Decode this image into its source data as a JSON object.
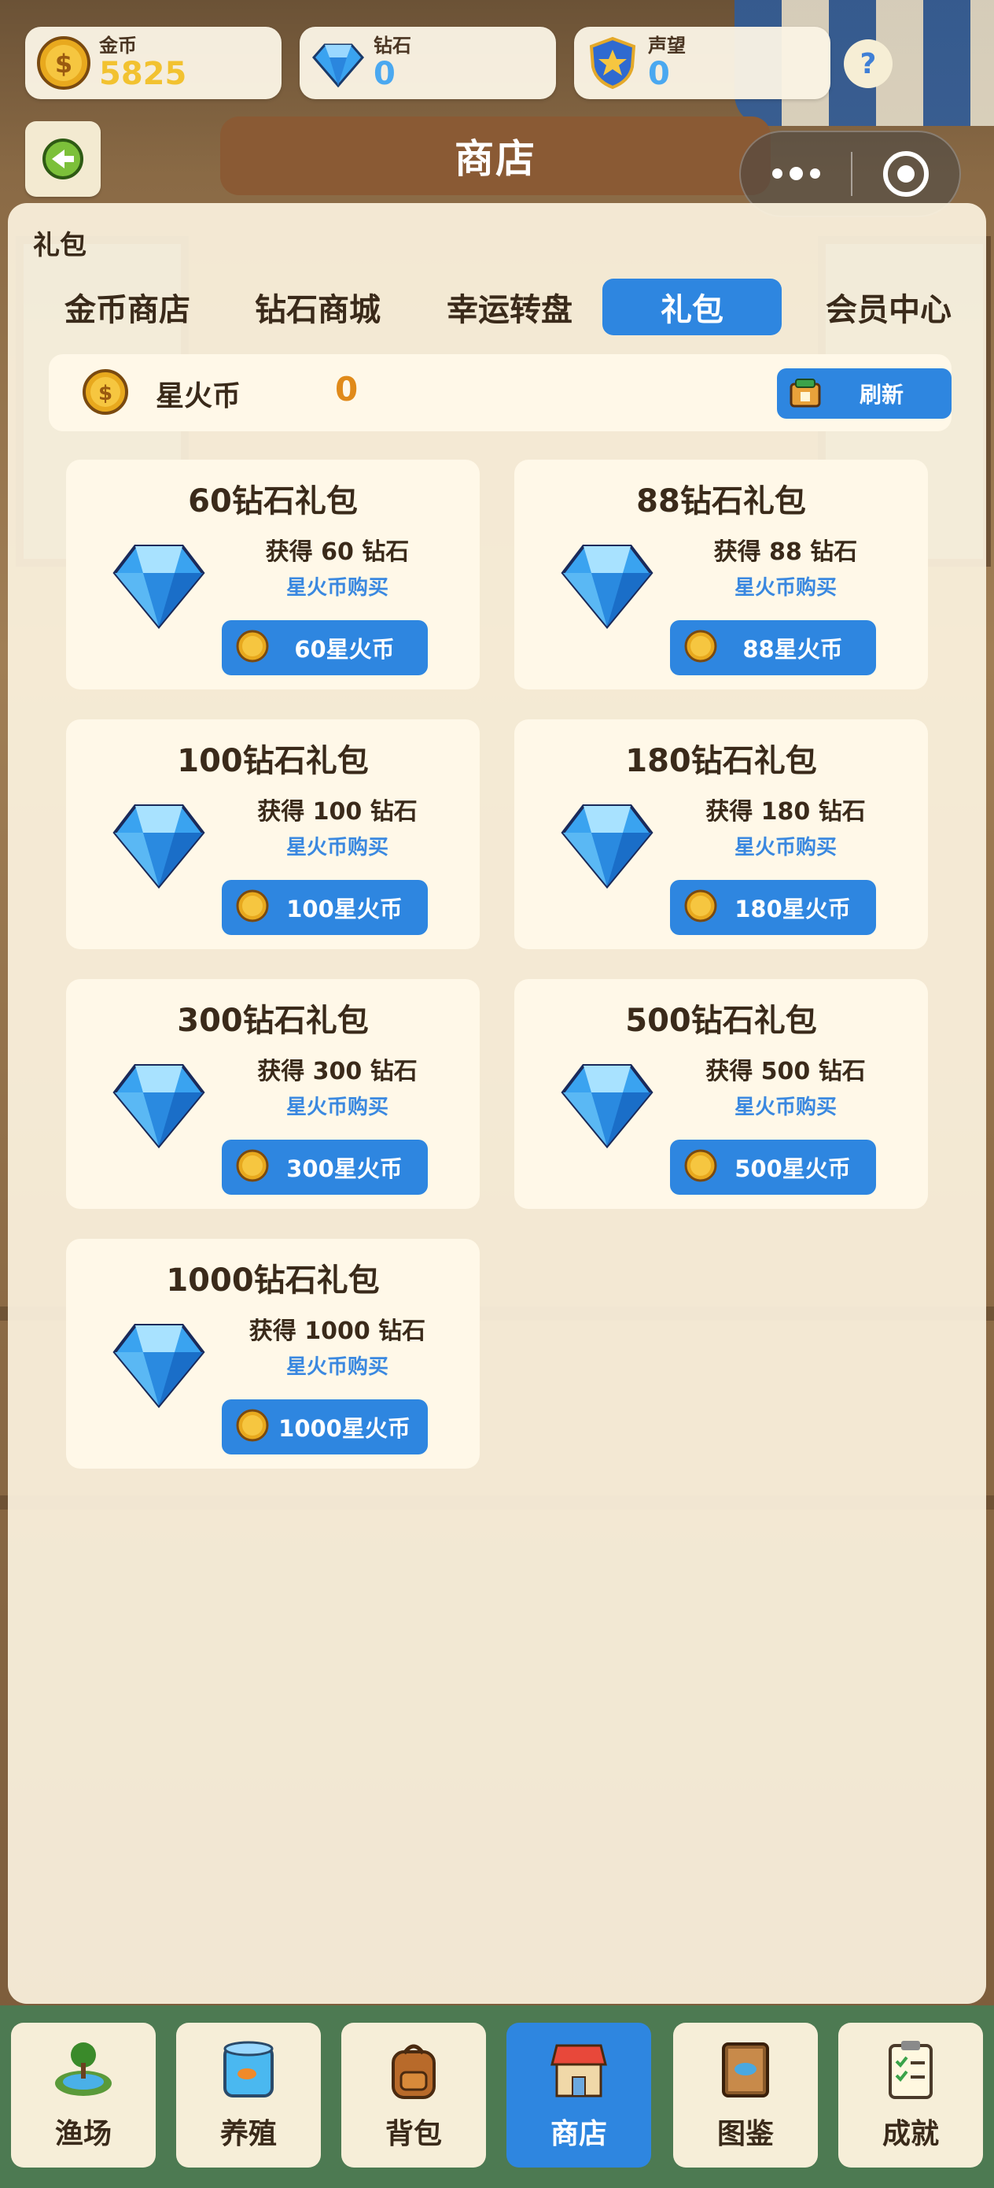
{
  "stats": [
    {
      "label": "金币",
      "value": "5825",
      "icon": "gold-coin-icon",
      "color": "#f2c230"
    },
    {
      "label": "钻石",
      "value": "0",
      "icon": "diamond-icon",
      "color": "#4aa8f0"
    },
    {
      "label": "声望",
      "value": "0",
      "icon": "shield-star-icon",
      "color": "#4aa8f0"
    }
  ],
  "header": {
    "help": "?",
    "title": "商店"
  },
  "panel": {
    "label": "礼包",
    "tabs": [
      "金币商店",
      "钻石商城",
      "幸运转盘",
      "礼包",
      "会员中心"
    ],
    "active_tab": 3,
    "currency": {
      "name": "星火币",
      "amount": "0",
      "refresh_label": "刷新"
    },
    "packs": [
      {
        "title": "60钻石礼包",
        "gain": "获得 60 钻石",
        "method": "星火币购买",
        "price": "60星火币"
      },
      {
        "title": "88钻石礼包",
        "gain": "获得 88 钻石",
        "method": "星火币购买",
        "price": "88星火币"
      },
      {
        "title": "100钻石礼包",
        "gain": "获得 100 钻石",
        "method": "星火币购买",
        "price": "100星火币"
      },
      {
        "title": "180钻石礼包",
        "gain": "获得 180 钻石",
        "method": "星火币购买",
        "price": "180星火币"
      },
      {
        "title": "300钻石礼包",
        "gain": "获得 300 钻石",
        "method": "星火币购买",
        "price": "300星火币"
      },
      {
        "title": "500钻石礼包",
        "gain": "获得 500 钻石",
        "method": "星火币购买",
        "price": "500星火币"
      },
      {
        "title": "1000钻石礼包",
        "gain": "获得 1000 钻石",
        "method": "星火币购买",
        "price": "1000星火币"
      }
    ]
  },
  "bottom_nav": [
    {
      "label": "渔场",
      "icon": "fishing-pond-icon"
    },
    {
      "label": "养殖",
      "icon": "fish-tank-icon"
    },
    {
      "label": "背包",
      "icon": "backpack-icon"
    },
    {
      "label": "商店",
      "icon": "shop-icon"
    },
    {
      "label": "图鉴",
      "icon": "fish-book-icon"
    },
    {
      "label": "成就",
      "icon": "checklist-icon"
    }
  ],
  "bottom_nav_active": 3,
  "colors": {
    "accent": "#2e86e0",
    "gold": "#f2c230",
    "orange": "#e08a1a",
    "brown_text": "#3a2a1a"
  }
}
